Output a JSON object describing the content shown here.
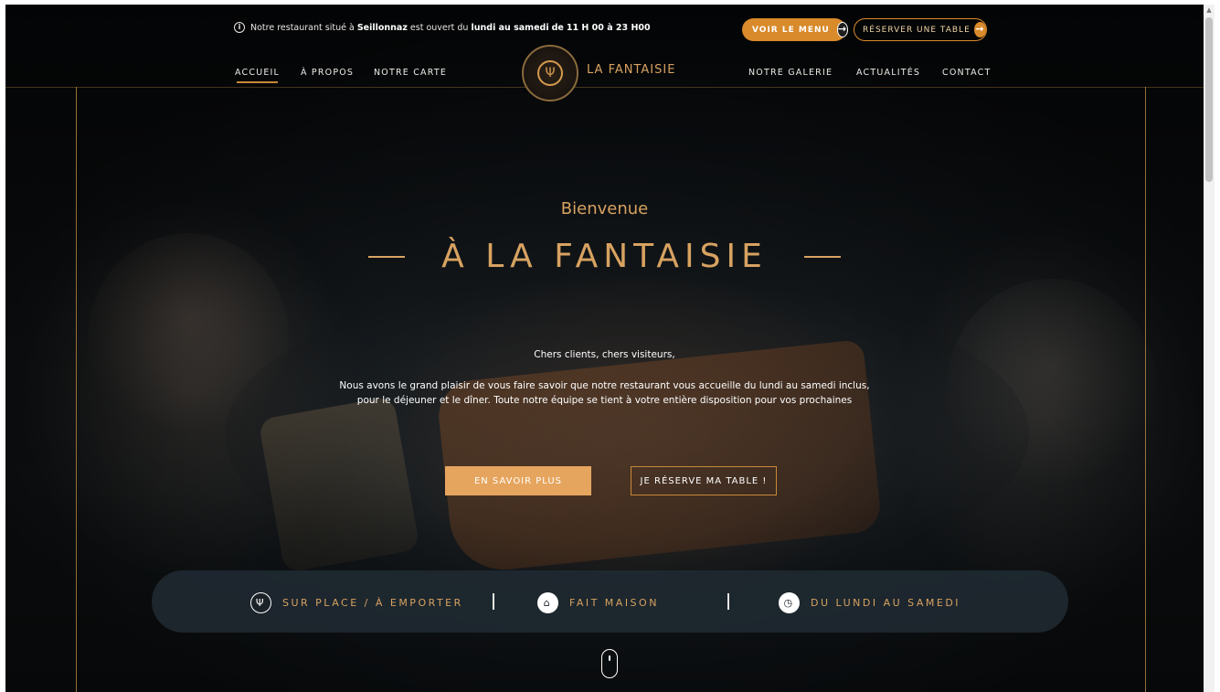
{
  "topbar": {
    "info_prefix": "Notre restaurant situé à",
    "info_place": "Seillonnaz",
    "info_middle": "est ouvert du",
    "info_days": "lundi au samedi",
    "info_de": "de",
    "info_hours": "11 H 00 à 23 H00",
    "menu_button": "VOIR LE MENU",
    "reserve_button": "RÉSERVER UNE TABLE"
  },
  "nav": {
    "left": [
      "ACCUEIL",
      "À PROPOS",
      "NOTRE CARTE"
    ],
    "right": [
      "NOTRE GALERIE",
      "ACTUALITÉS",
      "CONTACT"
    ],
    "active": "ACCUEIL"
  },
  "brand": "LA FANTAISIE",
  "hero": {
    "subtitle": "Bienvenue",
    "title": "À LA FANTAISIE",
    "greeting": "Chers clients, chers visiteurs,",
    "paragraph_line1": "Nous avons le grand plaisir de vous faire savoir que notre restaurant vous accueille du lundi au samedi inclus,",
    "paragraph_line2": "pour le déjeuner et le dîner. Toute notre équipe se tient à votre entière disposition pour vos prochaines",
    "cta_primary": "EN SAVOIR PLUS",
    "cta_secondary": "JE RÉSERVE MA TABLE !"
  },
  "features": [
    {
      "label": "SUR PLACE / À EMPORTER",
      "icon": "cutlery-icon"
    },
    {
      "label": "FAIT MAISON",
      "icon": "home-icon"
    },
    {
      "label": "DU LUNDI AU SAMEDI",
      "icon": "clock-icon"
    }
  ],
  "colors": {
    "accent": "#d98a2b",
    "gold": "#d7a261",
    "band": "#202a32"
  }
}
